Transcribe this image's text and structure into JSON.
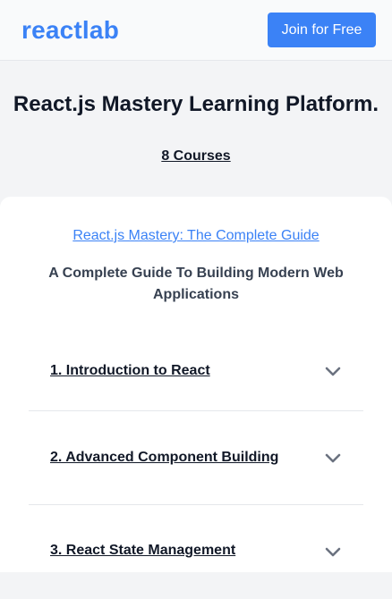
{
  "header": {
    "logo": "reactlab",
    "join_label": "Join for Free"
  },
  "hero": {
    "title": "React.js Mastery Learning Platform.",
    "courses_count": "8 Courses"
  },
  "course": {
    "link_text": "React.js Mastery: The Complete Guide",
    "subtitle": "A Complete Guide To Building Modern Web Applications",
    "modules": [
      {
        "title": "1. Introduction to React",
        "icon": "chevron-down-icon"
      },
      {
        "title": "2. Advanced Component Building",
        "icon": "chevron-down-icon"
      },
      {
        "title": "3. React State Management",
        "icon": "chevron-down-icon"
      }
    ]
  },
  "colors": {
    "accent": "#3b82f6",
    "background": "#f3f4f6",
    "card": "#ffffff",
    "text": "#111827",
    "muted_text": "#374151",
    "chevron": "#6b7280"
  }
}
